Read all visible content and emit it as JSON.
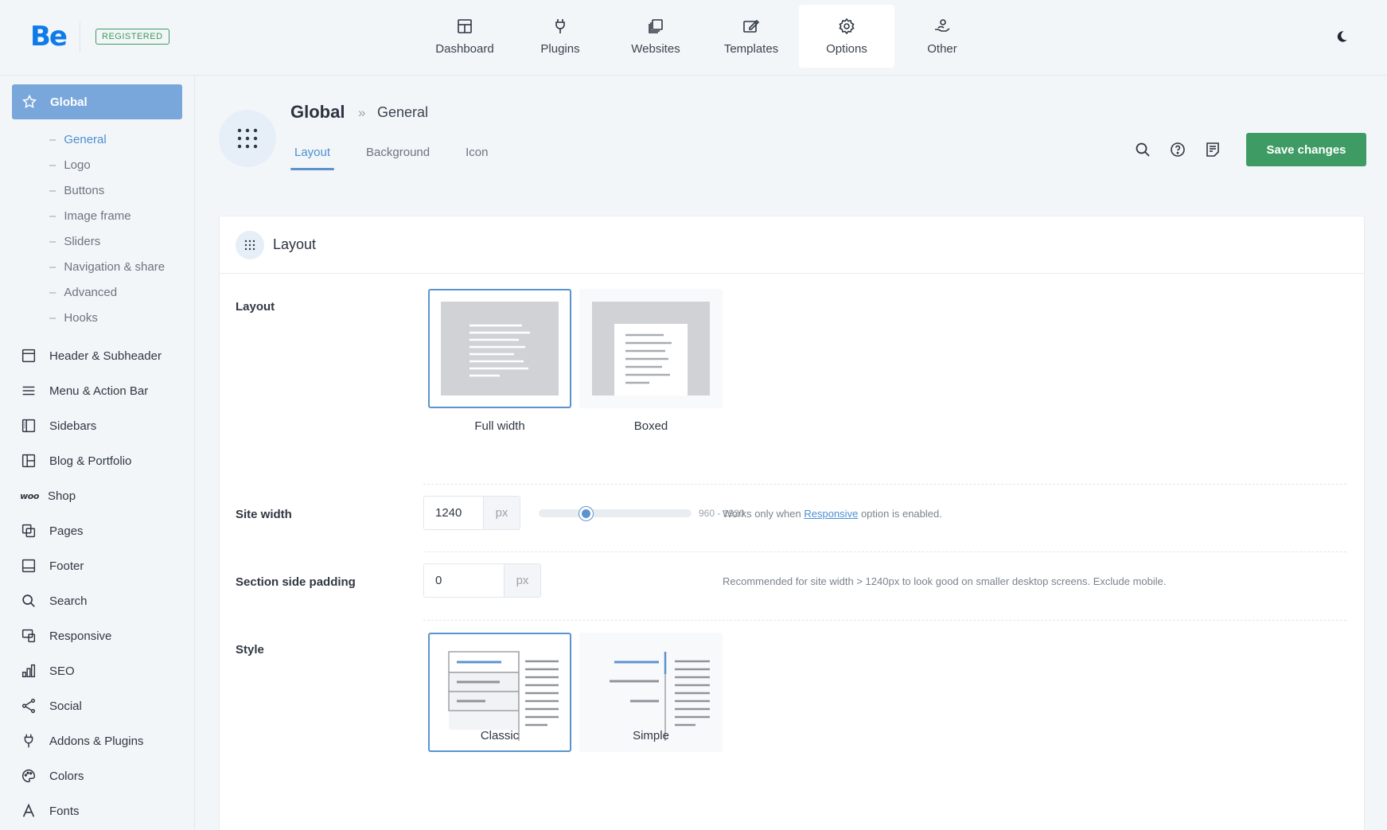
{
  "brand": {
    "logo": "Be",
    "badge": "REGISTERED"
  },
  "topnav": [
    {
      "label": "Dashboard",
      "icon": "dashboard-icon"
    },
    {
      "label": "Plugins",
      "icon": "plug-icon"
    },
    {
      "label": "Websites",
      "icon": "websites-icon"
    },
    {
      "label": "Templates",
      "icon": "templates-icon"
    },
    {
      "label": "Options",
      "icon": "gear-icon",
      "active": true
    },
    {
      "label": "Other",
      "icon": "hand-user-icon"
    }
  ],
  "sidebar": {
    "global": {
      "label": "Global",
      "icon": "star-icon"
    },
    "subitems": [
      "General",
      "Logo",
      "Buttons",
      "Image frame",
      "Sliders",
      "Navigation & share",
      "Advanced",
      "Hooks"
    ],
    "active_subitem": "General",
    "items": [
      {
        "label": "Header & Subheader",
        "icon": "header-icon"
      },
      {
        "label": "Menu & Action Bar",
        "icon": "menu-icon"
      },
      {
        "label": "Sidebars",
        "icon": "sidebar-icon"
      },
      {
        "label": "Blog & Portfolio",
        "icon": "blog-icon"
      },
      {
        "label": "Shop",
        "icon": "woo-icon",
        "glyph": "woo"
      },
      {
        "label": "Pages",
        "icon": "pages-icon"
      },
      {
        "label": "Footer",
        "icon": "footer-icon"
      },
      {
        "label": "Search",
        "icon": "search-icon"
      },
      {
        "label": "Responsive",
        "icon": "responsive-icon"
      },
      {
        "label": "SEO",
        "icon": "seo-icon"
      },
      {
        "label": "Social",
        "icon": "share-icon"
      },
      {
        "label": "Addons & Plugins",
        "icon": "plug-icon"
      },
      {
        "label": "Colors",
        "icon": "palette-icon"
      },
      {
        "label": "Fonts",
        "icon": "font-icon"
      }
    ]
  },
  "header": {
    "title": "Global",
    "separator": "»",
    "crumb": "General",
    "tabs": [
      "Layout",
      "Background",
      "Icon"
    ],
    "active_tab": "Layout",
    "save_label": "Save changes"
  },
  "card": {
    "title": "Layout",
    "layout": {
      "label": "Layout",
      "options": [
        "Full width",
        "Boxed"
      ],
      "selected": "Full width"
    },
    "site_width": {
      "label": "Site width",
      "value": "1240",
      "unit": "px",
      "range": "960 - 1920",
      "slider_fraction": 0.29,
      "hint_before": "Works only when",
      "hint_link": "Responsive",
      "hint_after": "option is enabled."
    },
    "side_padding": {
      "label": "Section side padding",
      "value": "0",
      "unit": "px",
      "hint": "Recommended for site width > 1240px to look good on smaller desktop screens. Exclude mobile."
    },
    "style": {
      "label": "Style",
      "options": [
        "Classic",
        "Simple"
      ],
      "selected": "Classic"
    }
  },
  "colors": {
    "accent": "#5b93cf",
    "active_sidebar": "#7aa7db",
    "save": "#3f9b64",
    "logo": "#0f7be8"
  }
}
